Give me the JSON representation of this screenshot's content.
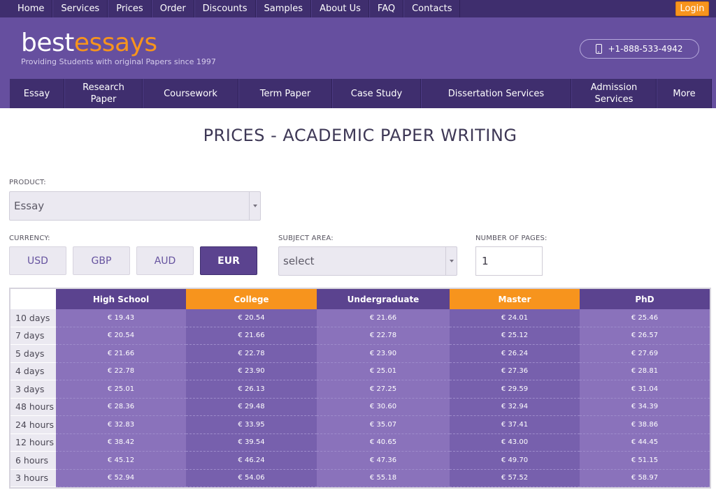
{
  "topnav": {
    "items": [
      "Home",
      "Services",
      "Prices",
      "Order",
      "Discounts",
      "Samples",
      "About Us",
      "FAQ",
      "Contacts"
    ],
    "login": "Login"
  },
  "header": {
    "logo_part1": "best",
    "logo_part2": "essays",
    "tagline": "Providing Students with original Papers since 1997",
    "phone": "+1-888-533-4942"
  },
  "categories": [
    "Essay",
    "Research Paper",
    "Coursework",
    "Term Paper",
    "Case Study",
    "Dissertation Services",
    "Admission Services",
    "More"
  ],
  "main": {
    "title": "PRICES - ACADEMIC PAPER WRITING",
    "product_label": "PRODUCT:",
    "product_value": "Essay",
    "currency_label": "CURRENCY:",
    "currencies": [
      "USD",
      "GBP",
      "AUD",
      "EUR"
    ],
    "active_currency": "EUR",
    "subject_label": "SUBJECT AREA:",
    "subject_value": "select",
    "pages_label": "NUMBER OF PAGES:",
    "pages_value": "1"
  },
  "colors": {
    "brand_purple": "#664f9f",
    "dark_purple": "#3f2e6e",
    "accent_orange": "#f7941d"
  },
  "price_table": {
    "columns": [
      "High School",
      "College",
      "Undergraduate",
      "Master",
      "PhD"
    ],
    "rows": [
      {
        "deadline": "10 days",
        "prices": [
          "€ 19.43",
          "€ 20.54",
          "€ 21.66",
          "€ 24.01",
          "€ 25.46"
        ]
      },
      {
        "deadline": "7 days",
        "prices": [
          "€ 20.54",
          "€ 21.66",
          "€ 22.78",
          "€ 25.12",
          "€ 26.57"
        ]
      },
      {
        "deadline": "5 days",
        "prices": [
          "€ 21.66",
          "€ 22.78",
          "€ 23.90",
          "€ 26.24",
          "€ 27.69"
        ]
      },
      {
        "deadline": "4 days",
        "prices": [
          "€ 22.78",
          "€ 23.90",
          "€ 25.01",
          "€ 27.36",
          "€ 28.81"
        ]
      },
      {
        "deadline": "3 days",
        "prices": [
          "€ 25.01",
          "€ 26.13",
          "€ 27.25",
          "€ 29.59",
          "€ 31.04"
        ]
      },
      {
        "deadline": "48 hours",
        "prices": [
          "€ 28.36",
          "€ 29.48",
          "€ 30.60",
          "€ 32.94",
          "€ 34.39"
        ]
      },
      {
        "deadline": "24 hours",
        "prices": [
          "€ 32.83",
          "€ 33.95",
          "€ 35.07",
          "€ 37.41",
          "€ 38.86"
        ]
      },
      {
        "deadline": "12 hours",
        "prices": [
          "€ 38.42",
          "€ 39.54",
          "€ 40.65",
          "€ 43.00",
          "€ 44.45"
        ]
      },
      {
        "deadline": "6 hours",
        "prices": [
          "€ 45.12",
          "€ 46.24",
          "€ 47.36",
          "€ 49.70",
          "€ 51.15"
        ]
      },
      {
        "deadline": "3 hours",
        "prices": [
          "€ 52.94",
          "€ 54.06",
          "€ 55.18",
          "€ 57.52",
          "€ 58.97"
        ]
      }
    ]
  }
}
